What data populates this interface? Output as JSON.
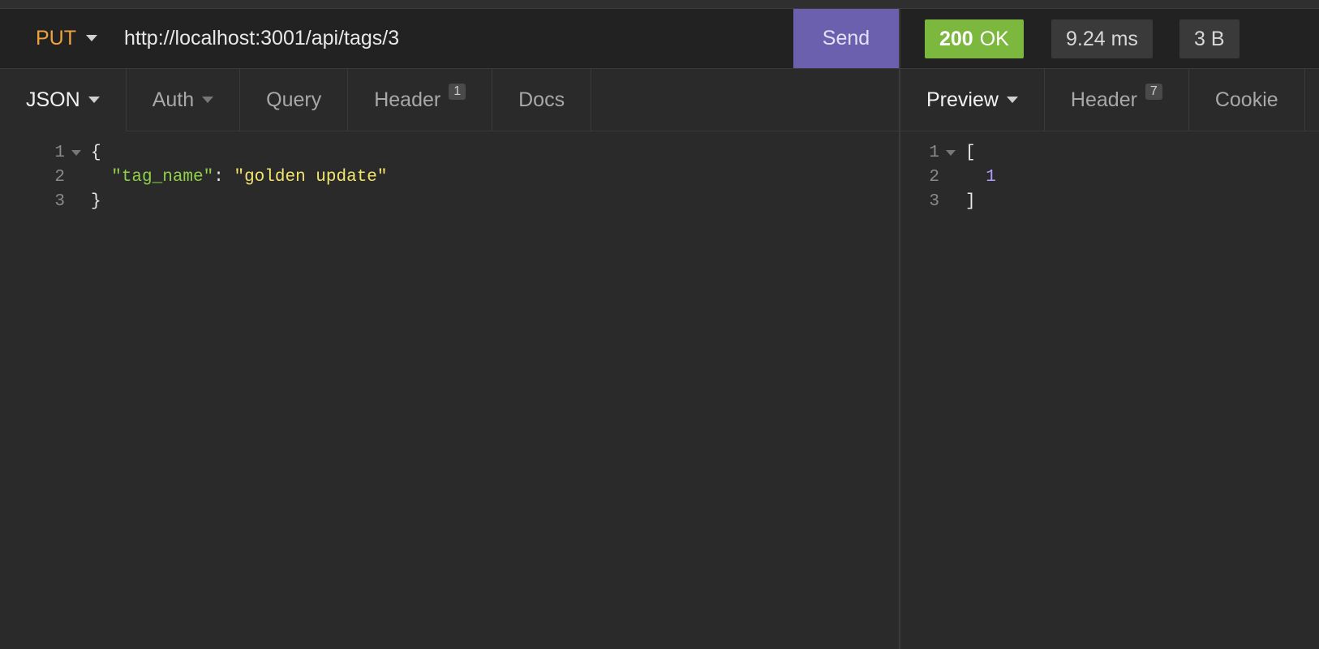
{
  "request": {
    "method": "PUT",
    "url": "http://localhost:3001/api/tags/3",
    "send_label": "Send",
    "tabs": [
      {
        "label": "JSON"
      },
      {
        "label": "Auth"
      },
      {
        "label": "Query"
      },
      {
        "label": "Header",
        "badge": "1"
      },
      {
        "label": "Docs"
      }
    ],
    "body_lines": [
      {
        "n": "1",
        "text": "{"
      },
      {
        "n": "2",
        "key": "\"tag_name\"",
        "sep": ": ",
        "value": "\"golden update\""
      },
      {
        "n": "3",
        "text": "}"
      }
    ]
  },
  "response": {
    "status_code": "200",
    "status_text": "OK",
    "time": "9.24 ms",
    "size": "3 B",
    "tabs": [
      {
        "label": "Preview"
      },
      {
        "label": "Header",
        "badge": "7"
      },
      {
        "label": "Cookie"
      }
    ],
    "body_lines": [
      {
        "n": "1",
        "text": "["
      },
      {
        "n": "2",
        "value": "1"
      },
      {
        "n": "3",
        "text": "]"
      }
    ]
  },
  "colors": {
    "method": "#f0a23c",
    "send_button": "#6a60ae",
    "status_ok": "#7cb83e",
    "json_key": "#8fd14a",
    "json_string": "#f2e46d",
    "json_number": "#b49bff"
  },
  "icons": [
    "chevron-down-icon",
    "fold-arrow-icon"
  ]
}
